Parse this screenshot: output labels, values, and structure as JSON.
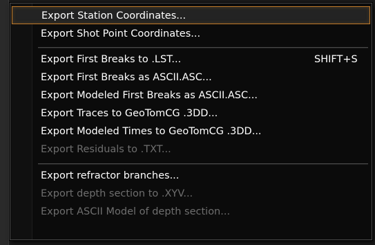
{
  "menu": {
    "items": [
      {
        "label": "Export Station Coordinates...",
        "shortcut": "",
        "disabled": false,
        "highlighted": true
      },
      {
        "label": "Export Shot Point Coordinates...",
        "shortcut": "",
        "disabled": false,
        "highlighted": false
      },
      {
        "label": "Export First Breaks to .LST...",
        "shortcut": "SHIFT+S",
        "disabled": false,
        "highlighted": false
      },
      {
        "label": "Export First Breaks as ASCII.ASC...",
        "shortcut": "",
        "disabled": false,
        "highlighted": false
      },
      {
        "label": "Export Modeled First Breaks as ASCII.ASC...",
        "shortcut": "",
        "disabled": false,
        "highlighted": false
      },
      {
        "label": "Export Traces to GeoTomCG .3DD...",
        "shortcut": "",
        "disabled": false,
        "highlighted": false
      },
      {
        "label": "Export Modeled Times to GeoTomCG .3DD...",
        "shortcut": "",
        "disabled": false,
        "highlighted": false
      },
      {
        "label": "Export Residuals to .TXT...",
        "shortcut": "",
        "disabled": true,
        "highlighted": false
      },
      {
        "label": "Export refractor branches...",
        "shortcut": "",
        "disabled": false,
        "highlighted": false
      },
      {
        "label": "Export depth section to .XYV...",
        "shortcut": "",
        "disabled": true,
        "highlighted": false
      },
      {
        "label": "Export ASCII Model of depth section...",
        "shortcut": "",
        "disabled": true,
        "highlighted": false
      }
    ]
  },
  "colors": {
    "highlight_border": "#c07a2a",
    "enabled_text": "#ffffff",
    "disabled_text": "#6e6e6e",
    "menu_background": "#0b0b0b"
  }
}
